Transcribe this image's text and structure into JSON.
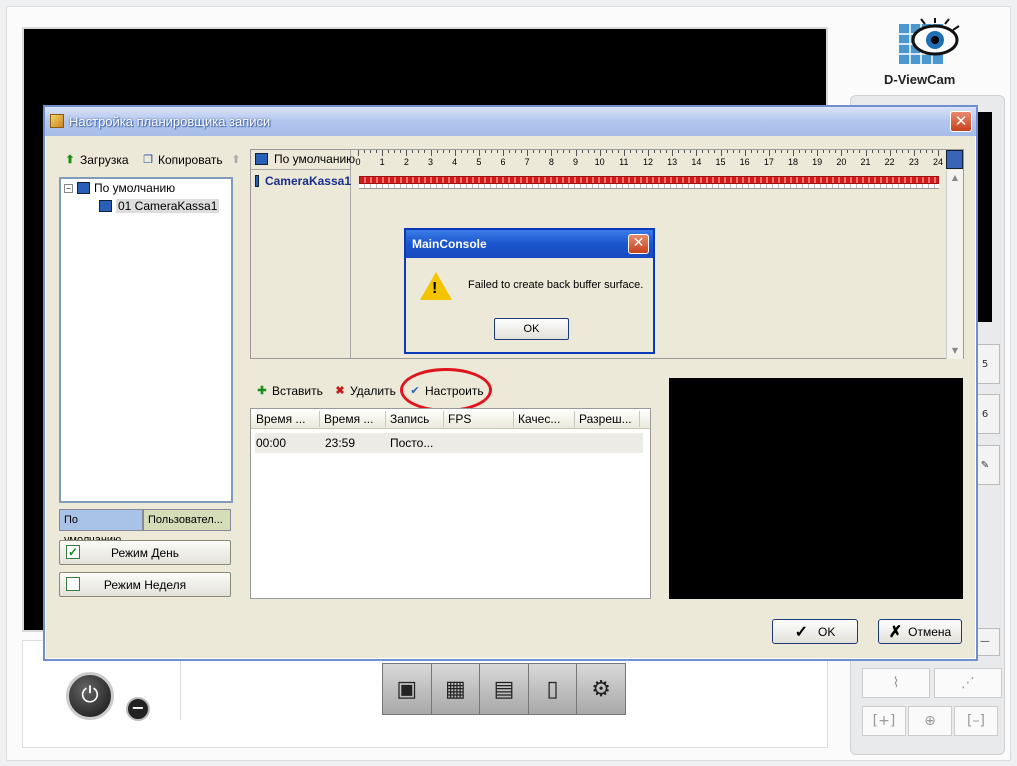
{
  "app": {
    "logo_text": "D-ViewCam",
    "side_buttons": [
      "5",
      "6"
    ],
    "bottom_toolbar": [
      "playback-icon",
      "clapper-icon",
      "schedule-icon",
      "document-icon",
      "gear-icon"
    ]
  },
  "dialog": {
    "title": "Настройка планировщика записи",
    "close_glyph": "✕",
    "toolbar": {
      "load_label": "Загрузка",
      "copy_label": "Копировать"
    },
    "tree": {
      "root_label": "По умолчанию",
      "child_label": "01 CameraKassa1"
    },
    "tabs": [
      "По умолчанию",
      "Пользовател..."
    ],
    "mode_day_label": "Режим День",
    "mode_week_label": "Режим Неделя",
    "timeline": {
      "header_label": "По умолчанию",
      "camera_label": "CameraKassa1",
      "hours": [
        "0",
        "1",
        "2",
        "3",
        "4",
        "5",
        "6",
        "7",
        "8",
        "9",
        "10",
        "11",
        "12",
        "13",
        "14",
        "15",
        "16",
        "17",
        "18",
        "19",
        "20",
        "21",
        "22",
        "23",
        "24"
      ]
    },
    "actions": {
      "insert_label": "Вставить",
      "delete_label": "Удалить",
      "configure_label": "Настроить"
    },
    "table": {
      "columns": [
        "Время ...",
        "Время ...",
        "Запись",
        "FPS",
        "Качес...",
        "Разреш..."
      ],
      "rows": [
        [
          "00:00",
          "23:59",
          "Посто...",
          "",
          "",
          ""
        ]
      ]
    },
    "ok_label": "OK",
    "cancel_label": "Отмена"
  },
  "message_box": {
    "title": "MainConsole",
    "message": "Failed to create back buffer surface.",
    "ok_label": "OK",
    "close_glyph": "✕"
  }
}
